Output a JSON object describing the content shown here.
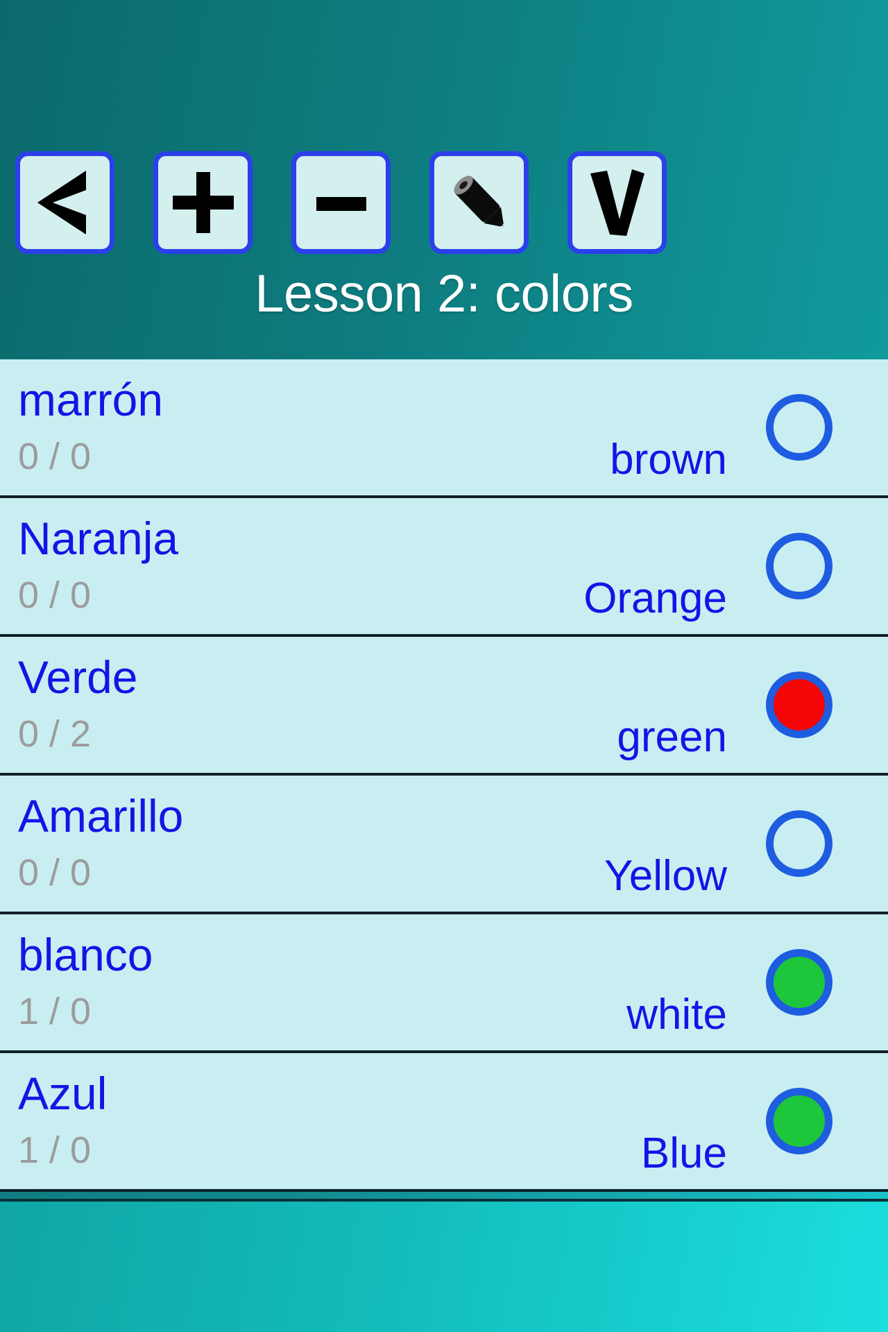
{
  "header": {
    "title": "Lesson 2: colors",
    "background_from": "#0c6a6c",
    "background_to": "#109a9d",
    "toolbar": [
      {
        "name": "back-button",
        "icon": "back-arrow-icon",
        "label": "<"
      },
      {
        "name": "add-button",
        "icon": "plus-icon",
        "label": "+"
      },
      {
        "name": "remove-button",
        "icon": "minus-icon",
        "label": "-"
      },
      {
        "name": "edit-button",
        "icon": "pencil-icon",
        "label": "edit"
      },
      {
        "name": "check-button",
        "icon": "checkmark-icon",
        "label": "V"
      }
    ]
  },
  "list": {
    "background": "#c9eef2",
    "term_color": "#1414e6",
    "counter_color": "#9c9c9c",
    "dot_ring_color": "#1e5ce0",
    "dot_red": "#f50505",
    "dot_green": "#1ec63c",
    "rows": [
      {
        "term": "marrón",
        "counter": "0 / 0",
        "translation": "brown",
        "status": "empty"
      },
      {
        "term": "Naranja",
        "counter": "0 / 0",
        "translation": "Orange",
        "status": "empty"
      },
      {
        "term": "Verde",
        "counter": "0 / 2",
        "translation": "green",
        "status": "red"
      },
      {
        "term": "Amarillo",
        "counter": "0 / 0",
        "translation": "Yellow",
        "status": "empty"
      },
      {
        "term": "blanco",
        "counter": "1 / 0",
        "translation": "white",
        "status": "green"
      },
      {
        "term": "Azul",
        "counter": "1 / 0",
        "translation": "Blue",
        "status": "green"
      }
    ]
  },
  "footer": {
    "background_from": "#10a6a4",
    "background_to": "#1bdede"
  }
}
